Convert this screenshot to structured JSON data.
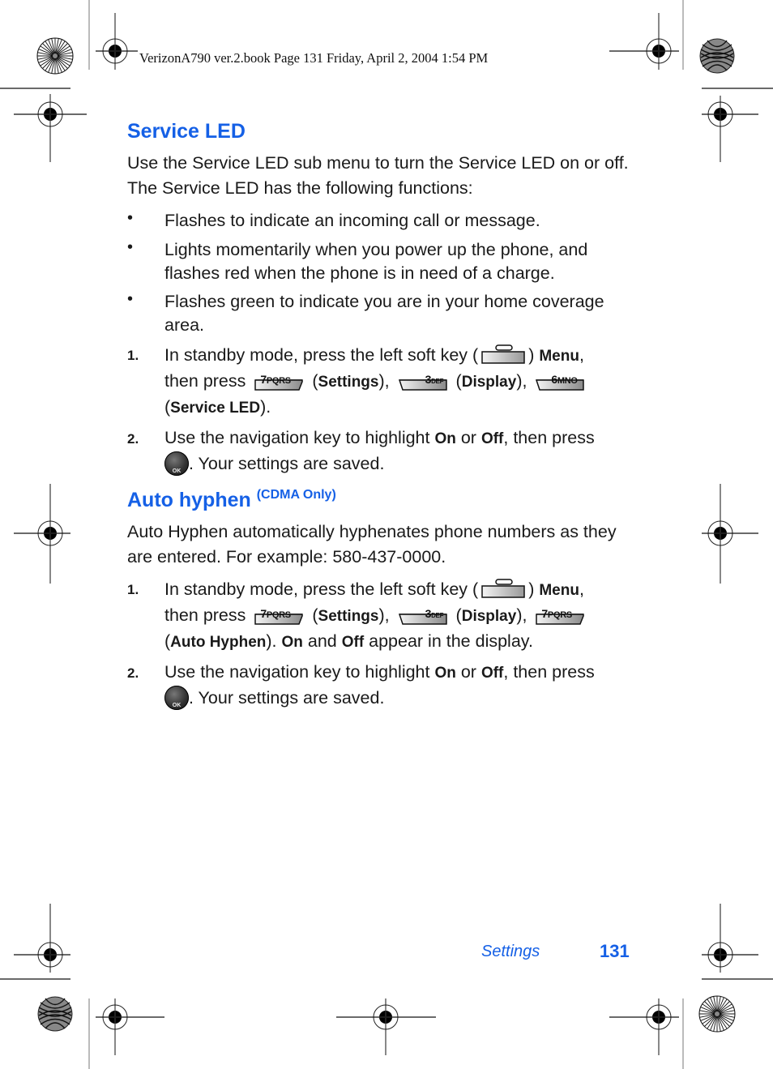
{
  "slug_line": "VerizonA790 ver.2.book  Page 131  Friday, April 2, 2004  1:54 PM",
  "service_led": {
    "heading": "Service LED",
    "intro": "Use the Service LED sub menu to turn the Service LED on or off. The Service LED has the following functions:",
    "bullets": [
      "Flashes to indicate an incoming call or message.",
      "Lights momentarily when you power up the phone, and flashes red when the phone is in need of a charge.",
      "Flashes green to indicate you are in your home coverage area."
    ],
    "steps": [
      {
        "number": "1.",
        "text_a": "In standby mode, press the left soft key (",
        "text_b": ") ",
        "menu": "Menu",
        "text_c": ",",
        "then_press": "then press ",
        "key1": {
          "digit": "7",
          "letters": "PQRS"
        },
        "settings": "Settings",
        "key2": {
          "digit": "3",
          "letters": "DEF"
        },
        "display": "Display",
        "key3": {
          "digit": "6",
          "letters": "MNO"
        },
        "final": "Service LED"
      },
      {
        "number": "2.",
        "text_a": "Use the navigation key to highlight ",
        "on": "On",
        "or": " or ",
        "off": "Off",
        "text_b": ", then press",
        "ok_label": "OK",
        "text_c": ". Your settings are saved."
      }
    ]
  },
  "auto_hyphen": {
    "heading": "Auto hyphen",
    "heading_note": "(CDMA Only)",
    "intro": "Auto Hyphen automatically hyphenates phone numbers as they are entered. For example: 580-437-0000.",
    "steps": [
      {
        "number": "1.",
        "text_a": "In standby mode, press the left soft key (",
        "text_b": ") ",
        "menu": "Menu",
        "text_c": ",",
        "then_press": "then press ",
        "key1": {
          "digit": "7",
          "letters": "PQRS"
        },
        "settings": "Settings",
        "key2": {
          "digit": "3",
          "letters": "DEF"
        },
        "display": "Display",
        "key3": {
          "digit": "7",
          "letters": "PQRS"
        },
        "final": "Auto Hyphen",
        "on": "On",
        "and": " and ",
        "off": "Off",
        "tail": " appear in the display."
      },
      {
        "number": "2.",
        "text_a": "Use the navigation key to highlight ",
        "on": "On",
        "or": " or ",
        "off": "Off",
        "text_b": ", then press",
        "ok_label": "OK",
        "text_c": ". Your settings are saved."
      }
    ]
  },
  "footer": {
    "section": "Settings",
    "page_number": "131"
  },
  "colors": {
    "accent_blue": "#1560e6",
    "text": "#1a1a1a"
  }
}
